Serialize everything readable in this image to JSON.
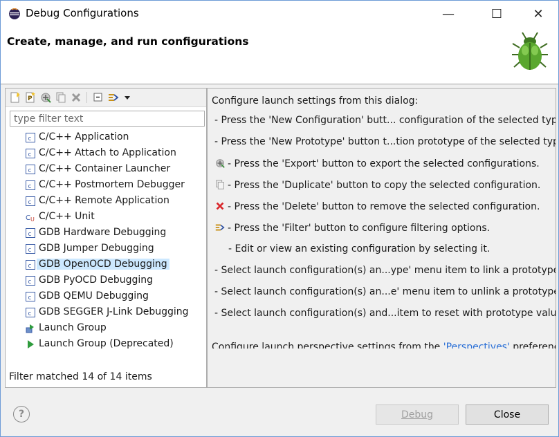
{
  "window": {
    "title": "Debug Configurations",
    "minimize_symbol": "—",
    "maximize_symbol": "☐",
    "close_symbol": "✕"
  },
  "banner": {
    "title": "Create, manage, and run configurations",
    "image_icon": "bug-icon"
  },
  "left": {
    "toolbar_icons": [
      "new-configuration-icon",
      "new-prototype-icon",
      "export-icon",
      "duplicate-icon",
      "delete-icon",
      "collapse-all-icon",
      "filter-icon",
      "view-menu-icon"
    ],
    "filter_placeholder": "type filter text",
    "items": [
      {
        "label": "C/C++ Application",
        "icon": "c-config-icon"
      },
      {
        "label": "C/C++ Attach to Application",
        "icon": "c-config-icon"
      },
      {
        "label": "C/C++ Container Launcher",
        "icon": "c-config-icon"
      },
      {
        "label": "C/C++ Postmortem Debugger",
        "icon": "c-config-icon"
      },
      {
        "label": "C/C++ Remote Application",
        "icon": "c-config-icon"
      },
      {
        "label": "C/C++ Unit",
        "icon": "cu-unit-icon"
      },
      {
        "label": "GDB Hardware Debugging",
        "icon": "c-config-icon"
      },
      {
        "label": "GDB Jumper Debugging",
        "icon": "c-config-icon"
      },
      {
        "label": "GDB OpenOCD Debugging",
        "icon": "c-config-icon",
        "selected": true
      },
      {
        "label": "GDB PyOCD Debugging",
        "icon": "c-config-icon"
      },
      {
        "label": "GDB QEMU Debugging",
        "icon": "c-config-icon"
      },
      {
        "label": "GDB SEGGER J-Link Debugging",
        "icon": "c-config-icon"
      },
      {
        "label": "Launch Group",
        "icon": "launch-group-icon"
      },
      {
        "label": "Launch Group (Deprecated)",
        "icon": "launch-group-deprecated-icon"
      }
    ],
    "status": "Filter matched 14 of 14 items"
  },
  "right": {
    "intro": "Configure launch settings from this dialog:",
    "lines": [
      {
        "icon": "",
        "text": "- Press the 'New Configuration' butt... configuration of the selected type."
      },
      {
        "icon": "",
        "text": "- Press the 'New Prototype' button t...tion prototype of the selected type."
      },
      {
        "icon": "export-icon",
        "text": "- Press the 'Export' button to export the selected configurations."
      },
      {
        "icon": "duplicate-icon",
        "text": "- Press the 'Duplicate' button to copy the selected configuration."
      },
      {
        "icon": "delete-icon",
        "text": "- Press the 'Delete' button to remove the selected configuration."
      },
      {
        "icon": "filter-icon",
        "text": "- Press the 'Filter' button to configure filtering options."
      },
      {
        "icon": "",
        "text": "- Edit or view an existing configuration by selecting it.",
        "indent": true
      },
      {
        "icon": "",
        "text": "- Select launch configuration(s) an...ype' menu item to link a prototype."
      },
      {
        "icon": "",
        "text": "- Select launch configuration(s) an...e' menu item to unlink a prototype."
      },
      {
        "icon": "",
        "text": "- Select launch configuration(s) and...item to reset with prototype values."
      }
    ],
    "perspectives_prefix": "Configure launch perspective settings from the ",
    "perspectives_link": "'Perspectives'",
    "perspectives_suffix": " preference"
  },
  "footer": {
    "help_symbol": "?",
    "debug_label": "Debug",
    "close_label": "Close"
  },
  "colors": {
    "selection": "#cce8ff",
    "link": "#2a6fd6",
    "delete_red": "#d9262a",
    "window_border": "#6b9ad6"
  }
}
